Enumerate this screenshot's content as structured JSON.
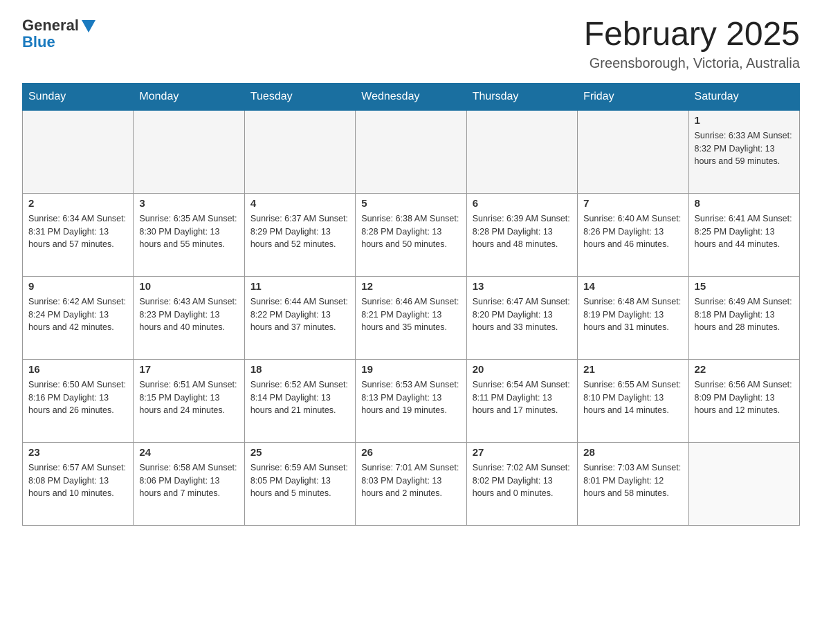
{
  "logo": {
    "general": "General",
    "blue": "Blue"
  },
  "title": "February 2025",
  "location": "Greensborough, Victoria, Australia",
  "days_of_week": [
    "Sunday",
    "Monday",
    "Tuesday",
    "Wednesday",
    "Thursday",
    "Friday",
    "Saturday"
  ],
  "weeks": [
    [
      {
        "day": "",
        "info": ""
      },
      {
        "day": "",
        "info": ""
      },
      {
        "day": "",
        "info": ""
      },
      {
        "day": "",
        "info": ""
      },
      {
        "day": "",
        "info": ""
      },
      {
        "day": "",
        "info": ""
      },
      {
        "day": "1",
        "info": "Sunrise: 6:33 AM\nSunset: 8:32 PM\nDaylight: 13 hours and 59 minutes."
      }
    ],
    [
      {
        "day": "2",
        "info": "Sunrise: 6:34 AM\nSunset: 8:31 PM\nDaylight: 13 hours and 57 minutes."
      },
      {
        "day": "3",
        "info": "Sunrise: 6:35 AM\nSunset: 8:30 PM\nDaylight: 13 hours and 55 minutes."
      },
      {
        "day": "4",
        "info": "Sunrise: 6:37 AM\nSunset: 8:29 PM\nDaylight: 13 hours and 52 minutes."
      },
      {
        "day": "5",
        "info": "Sunrise: 6:38 AM\nSunset: 8:28 PM\nDaylight: 13 hours and 50 minutes."
      },
      {
        "day": "6",
        "info": "Sunrise: 6:39 AM\nSunset: 8:28 PM\nDaylight: 13 hours and 48 minutes."
      },
      {
        "day": "7",
        "info": "Sunrise: 6:40 AM\nSunset: 8:26 PM\nDaylight: 13 hours and 46 minutes."
      },
      {
        "day": "8",
        "info": "Sunrise: 6:41 AM\nSunset: 8:25 PM\nDaylight: 13 hours and 44 minutes."
      }
    ],
    [
      {
        "day": "9",
        "info": "Sunrise: 6:42 AM\nSunset: 8:24 PM\nDaylight: 13 hours and 42 minutes."
      },
      {
        "day": "10",
        "info": "Sunrise: 6:43 AM\nSunset: 8:23 PM\nDaylight: 13 hours and 40 minutes."
      },
      {
        "day": "11",
        "info": "Sunrise: 6:44 AM\nSunset: 8:22 PM\nDaylight: 13 hours and 37 minutes."
      },
      {
        "day": "12",
        "info": "Sunrise: 6:46 AM\nSunset: 8:21 PM\nDaylight: 13 hours and 35 minutes."
      },
      {
        "day": "13",
        "info": "Sunrise: 6:47 AM\nSunset: 8:20 PM\nDaylight: 13 hours and 33 minutes."
      },
      {
        "day": "14",
        "info": "Sunrise: 6:48 AM\nSunset: 8:19 PM\nDaylight: 13 hours and 31 minutes."
      },
      {
        "day": "15",
        "info": "Sunrise: 6:49 AM\nSunset: 8:18 PM\nDaylight: 13 hours and 28 minutes."
      }
    ],
    [
      {
        "day": "16",
        "info": "Sunrise: 6:50 AM\nSunset: 8:16 PM\nDaylight: 13 hours and 26 minutes."
      },
      {
        "day": "17",
        "info": "Sunrise: 6:51 AM\nSunset: 8:15 PM\nDaylight: 13 hours and 24 minutes."
      },
      {
        "day": "18",
        "info": "Sunrise: 6:52 AM\nSunset: 8:14 PM\nDaylight: 13 hours and 21 minutes."
      },
      {
        "day": "19",
        "info": "Sunrise: 6:53 AM\nSunset: 8:13 PM\nDaylight: 13 hours and 19 minutes."
      },
      {
        "day": "20",
        "info": "Sunrise: 6:54 AM\nSunset: 8:11 PM\nDaylight: 13 hours and 17 minutes."
      },
      {
        "day": "21",
        "info": "Sunrise: 6:55 AM\nSunset: 8:10 PM\nDaylight: 13 hours and 14 minutes."
      },
      {
        "day": "22",
        "info": "Sunrise: 6:56 AM\nSunset: 8:09 PM\nDaylight: 13 hours and 12 minutes."
      }
    ],
    [
      {
        "day": "23",
        "info": "Sunrise: 6:57 AM\nSunset: 8:08 PM\nDaylight: 13 hours and 10 minutes."
      },
      {
        "day": "24",
        "info": "Sunrise: 6:58 AM\nSunset: 8:06 PM\nDaylight: 13 hours and 7 minutes."
      },
      {
        "day": "25",
        "info": "Sunrise: 6:59 AM\nSunset: 8:05 PM\nDaylight: 13 hours and 5 minutes."
      },
      {
        "day": "26",
        "info": "Sunrise: 7:01 AM\nSunset: 8:03 PM\nDaylight: 13 hours and 2 minutes."
      },
      {
        "day": "27",
        "info": "Sunrise: 7:02 AM\nSunset: 8:02 PM\nDaylight: 13 hours and 0 minutes."
      },
      {
        "day": "28",
        "info": "Sunrise: 7:03 AM\nSunset: 8:01 PM\nDaylight: 12 hours and 58 minutes."
      },
      {
        "day": "",
        "info": ""
      }
    ]
  ]
}
